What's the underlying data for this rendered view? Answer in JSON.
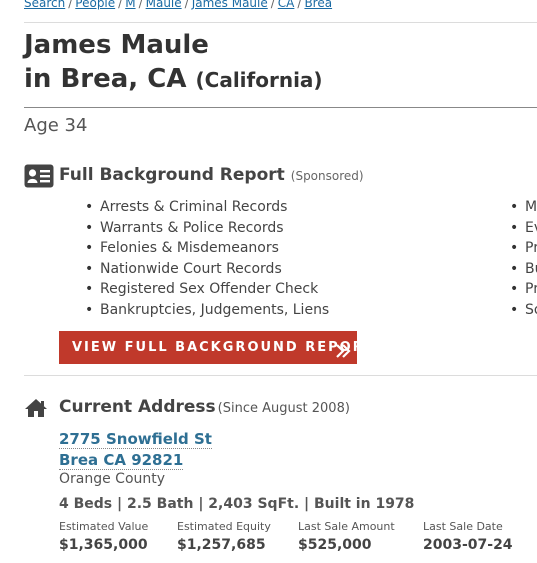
{
  "breadcrumb": {
    "items": [
      "Search",
      "People",
      "M",
      "Maule",
      "James Maule",
      "CA",
      "Brea"
    ],
    "separator": "/"
  },
  "header": {
    "name": "James Maule",
    "location_prefix": "in",
    "location": "Brea, CA",
    "state_full": "(California)"
  },
  "age": "Age 34",
  "background_report": {
    "icon": "id-card-icon",
    "title": "Full Background Report",
    "sponsored": "(Sponsored)",
    "left_items": [
      "Arrests & Criminal Records",
      "Warrants & Police Records",
      "Felonies & Misdemeanors",
      "Nationwide Court Records",
      "Registered Sex Offender Check",
      "Bankruptcies, Judgements, Liens"
    ],
    "right_items_truncated": [
      "M",
      "Ev",
      "Pr",
      "Bu",
      "Pr",
      "So"
    ],
    "cta_label": "VIEW FULL BACKGROUND REPORT",
    "cta_icon": "double-chevron-right-icon",
    "cta_color": "#c0392b"
  },
  "current_address": {
    "icon": "home-icon",
    "title": "Current Address",
    "since": "(Since August 2008)",
    "street": "2775 Snowfield St",
    "city_line": "Brea CA 92821",
    "county": "Orange County",
    "facts": "4 Beds | 2.5 Bath | 2,403 SqFt. | Built in 1978",
    "stats": [
      {
        "label": "Estimated Value",
        "value": "$1,365,000"
      },
      {
        "label": "Estimated Equity",
        "value": "$1,257,685"
      },
      {
        "label": "Last Sale Amount",
        "value": "$525,000"
      },
      {
        "label": "Last Sale Date",
        "value": "2003-07-24"
      }
    ]
  },
  "colors": {
    "link": "#1a6aa3",
    "address_link": "#2e6f93",
    "text": "#333333"
  }
}
